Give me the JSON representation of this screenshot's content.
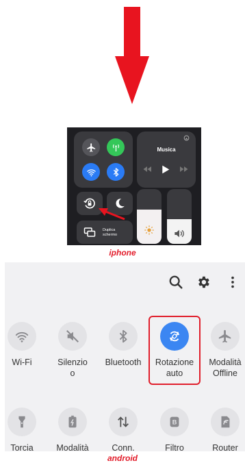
{
  "iphone": {
    "music_label": "Musica",
    "mirror_label_line1": "Duplica",
    "mirror_label_line2": "schermo",
    "caption": "iphone"
  },
  "android": {
    "top_icons": [
      "search-icon",
      "gear-icon",
      "more-vert-icon"
    ],
    "tiles_row1": [
      {
        "label": "Wi-Fi",
        "icon": "wifi-icon",
        "active": false
      },
      {
        "label": "Silenzio\no",
        "icon": "mute-icon",
        "active": false
      },
      {
        "label": "Bluetooth",
        "icon": "bluetooth-icon",
        "active": false
      },
      {
        "label": "Rotazione\nauto",
        "icon": "auto-rotate-icon",
        "active": true
      },
      {
        "label": "Modalità\nOffline",
        "icon": "airplane-icon",
        "active": false
      }
    ],
    "tiles_row2": [
      {
        "label": "Torcia",
        "icon": "flashlight-icon"
      },
      {
        "label": "Modalità",
        "icon": "battery-mode-icon"
      },
      {
        "label": "Conn.",
        "icon": "data-transfer-icon"
      },
      {
        "label": "Filtro",
        "icon": "filter-icon"
      },
      {
        "label": "Router",
        "icon": "hotspot-icon"
      }
    ],
    "caption": "android"
  },
  "colors": {
    "arrow": "#e8141f",
    "ios_blue": "#2a7bf5",
    "ios_green": "#34c759",
    "android_active": "#3b86f2",
    "highlight": "#e01e2b"
  }
}
